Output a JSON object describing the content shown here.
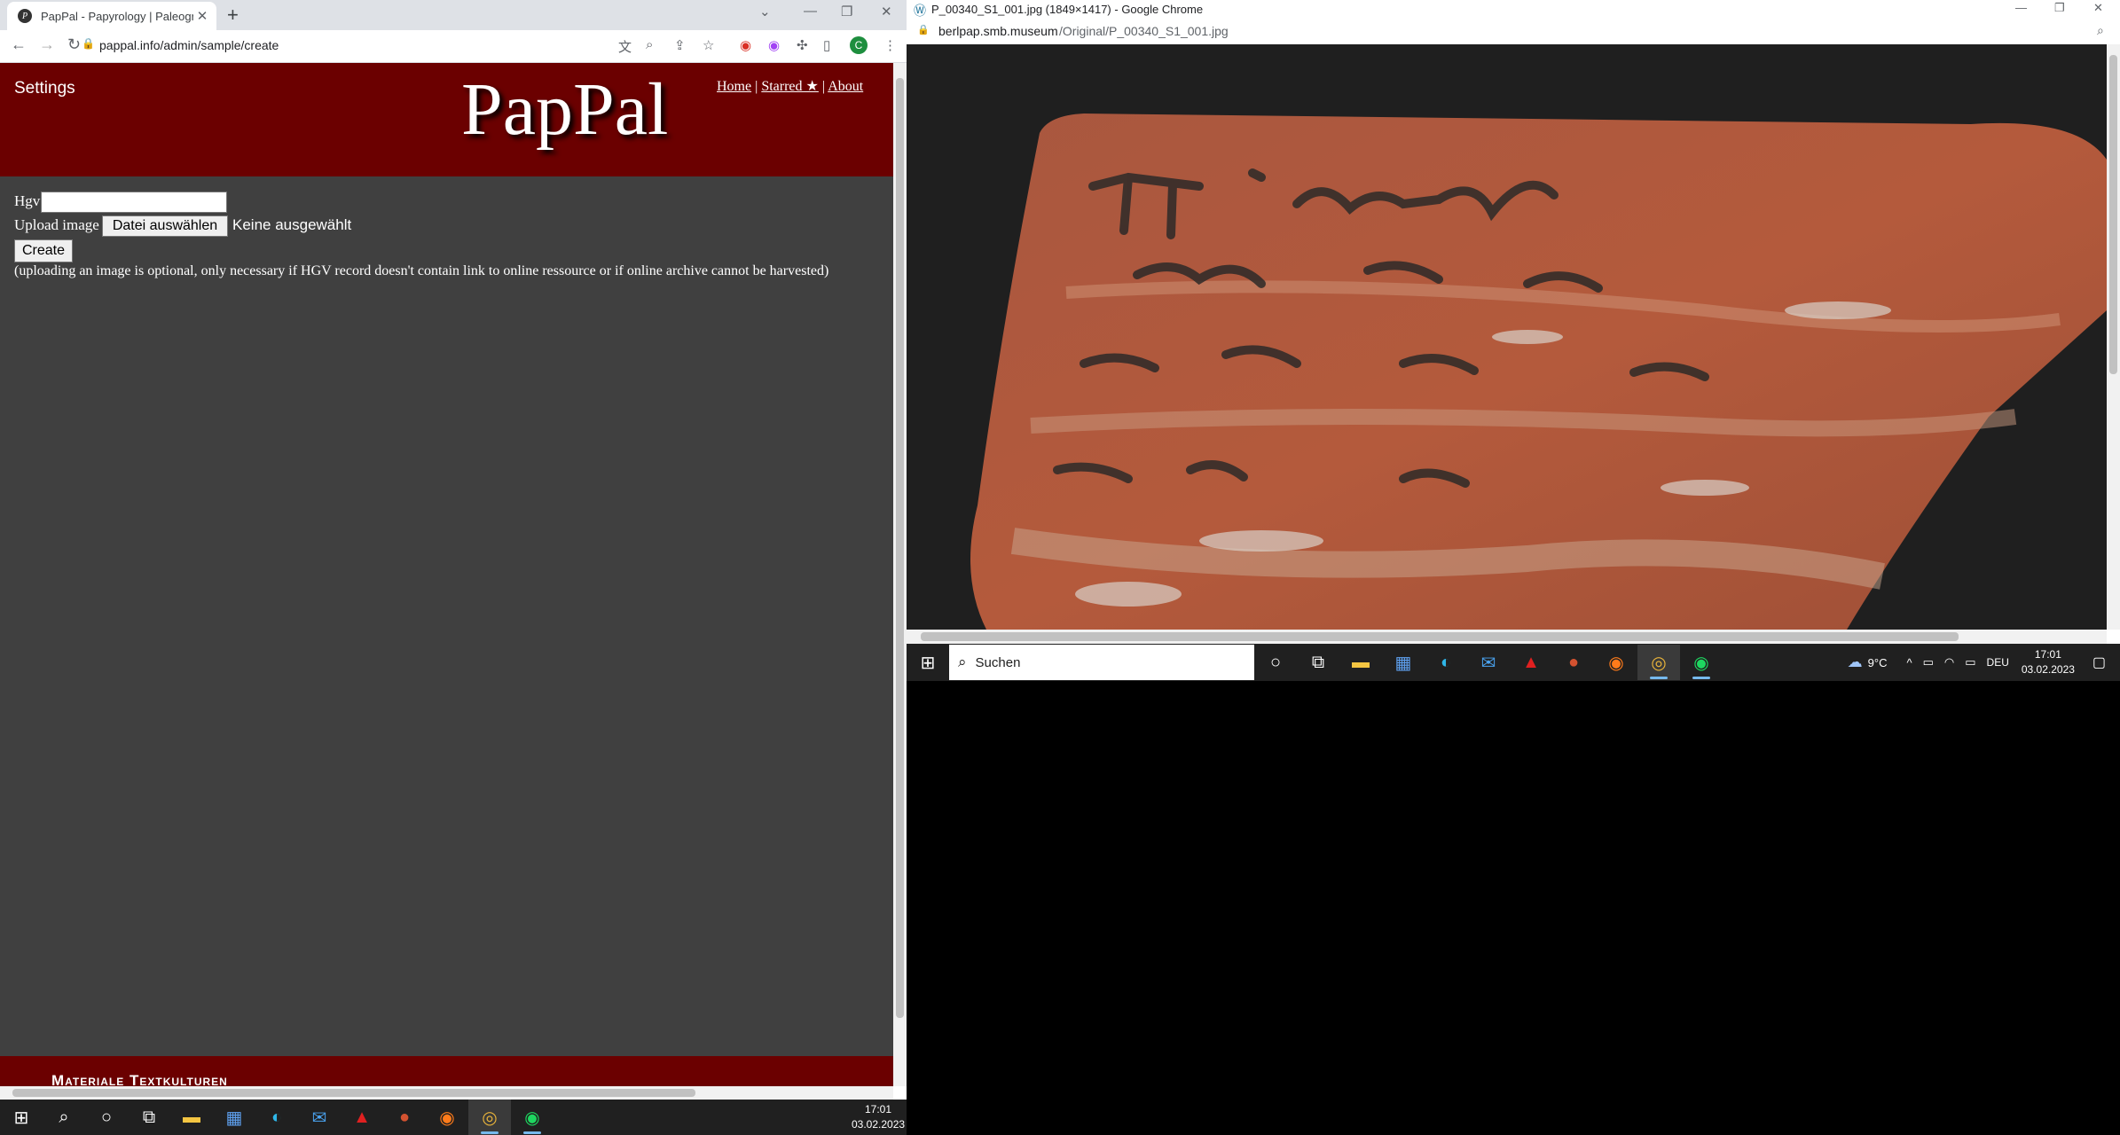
{
  "left_window": {
    "tab_title": "PapPal - Papyrology | Paleography",
    "url": "pappal.info/admin/sample/create",
    "profile_initial": "C",
    "page": {
      "settings_label": "Settings",
      "logo": "PapPal",
      "nav": {
        "home": "Home",
        "starred": "Starred ★",
        "about": "About",
        "sep": "|"
      },
      "hgv_label": "Hgv",
      "hgv_value": "",
      "upload_label": "Upload image",
      "file_button": "Datei auswählen",
      "no_file": "Keine ausgewählt",
      "create_button": "Create",
      "note": "(uploading an image is optional, only necessary if HGV record doesn't contain link to online ressource or if online archive cannot be harvested)",
      "footer_text": "Materiale Textkulturen"
    }
  },
  "right_window": {
    "title": "P_00340_S1_001.jpg (1849×1417) - Google Chrome",
    "url_host": "berlpap.smb.museum",
    "url_path": "/Original/P_00340_S1_001.jpg"
  },
  "taskbar_right": {
    "search_placeholder": "Suchen",
    "weather": "9°C",
    "language": "DEU",
    "time": "17:01",
    "date": "03.02.2023"
  },
  "taskbar_left": {
    "time": "17:01",
    "date": "03.02.2023"
  },
  "colors": {
    "header_red": "#6b0000",
    "page_bg": "#404040",
    "taskbar": "#202020"
  }
}
